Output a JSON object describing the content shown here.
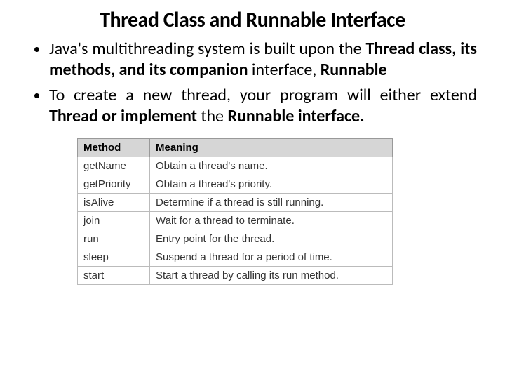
{
  "title": "Thread Class and Runnable Interface",
  "bullet1": {
    "pre": "Java's multithreading system is built upon the ",
    "bold1": "Thread class, its methods, and its companion",
    "mid": " interface, ",
    "bold2": "Runnable"
  },
  "bullet2": {
    "pre": "To create a new thread, your program will either extend ",
    "bold1": "Thread or implement",
    "mid": " the ",
    "bold2": "Runnable interface."
  },
  "table": {
    "headers": {
      "c0": "Method",
      "c1": "Meaning"
    },
    "rows": [
      {
        "c0": "getName",
        "c1": "Obtain a thread's name."
      },
      {
        "c0": "getPriority",
        "c1": "Obtain a thread's priority."
      },
      {
        "c0": "isAlive",
        "c1": "Determine if a thread is still running."
      },
      {
        "c0": "join",
        "c1": "Wait for a thread to terminate."
      },
      {
        "c0": "run",
        "c1": "Entry point for the thread."
      },
      {
        "c0": "sleep",
        "c1": "Suspend a thread for a period of time."
      },
      {
        "c0": "start",
        "c1": "Start a thread by calling its run method."
      }
    ]
  }
}
